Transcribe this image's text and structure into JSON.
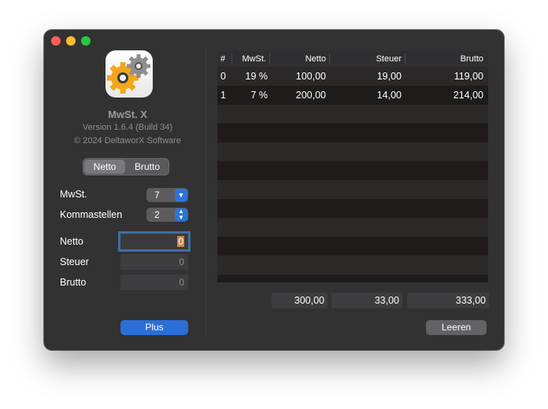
{
  "app": {
    "name": "MwSt. X",
    "version": "Version 1.6.4 (Build 34)",
    "copyright": "© 2024 DeltaworX Software",
    "icon": "gears-icon"
  },
  "mode": {
    "options": [
      "Netto",
      "Brutto"
    ],
    "selected": "Netto"
  },
  "settings": {
    "mwst_label": "MwSt.",
    "mwst_value": "7",
    "kommastellen_label": "Kommastellen",
    "kommastellen_value": "2"
  },
  "inputs": {
    "netto_label": "Netto",
    "netto_value": "0",
    "steuer_label": "Steuer",
    "steuer_value": "0",
    "brutto_label": "Brutto",
    "brutto_value": "0"
  },
  "buttons": {
    "plus": "Plus",
    "leeren": "Leeren"
  },
  "table": {
    "columns": [
      "#",
      "MwSt.",
      "Netto",
      "Steuer",
      "Brutto"
    ],
    "rows": [
      {
        "index": "0",
        "mwst": "19 %",
        "netto": "100,00",
        "steuer": "19,00",
        "brutto": "119,00"
      },
      {
        "index": "1",
        "mwst": "7 %",
        "netto": "200,00",
        "steuer": "14,00",
        "brutto": "214,00"
      }
    ]
  },
  "totals": {
    "netto": "300,00",
    "steuer": "33,00",
    "brutto": "333,00"
  },
  "colors": {
    "accent": "#2b74d9",
    "window_bg": "#323233",
    "row_odd": "#2b2928",
    "row_even": "#1e1b1a"
  }
}
